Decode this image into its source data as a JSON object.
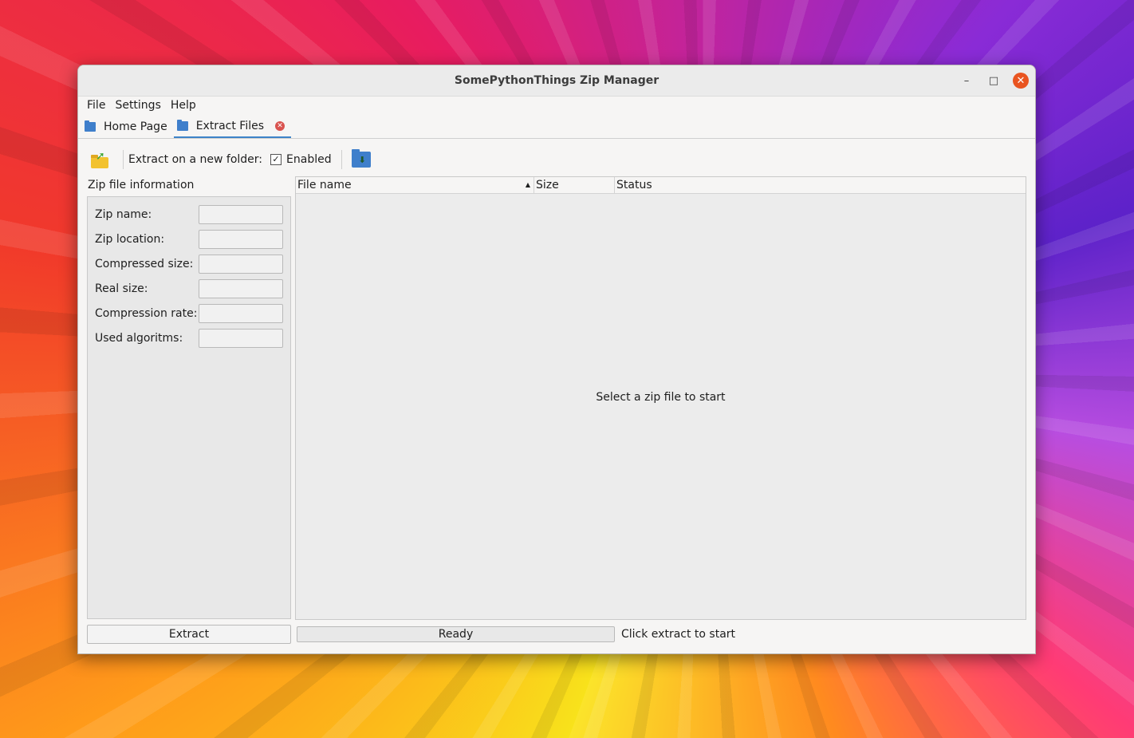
{
  "window": {
    "title": "SomePythonThings Zip Manager"
  },
  "menu": [
    "File",
    "Settings",
    "Help"
  ],
  "tabs": [
    {
      "label": "Home Page",
      "active": false
    },
    {
      "label": "Extract Files",
      "active": true
    }
  ],
  "toolbar": {
    "new_folder_label": "Extract on a new folder:",
    "enabled_label": "Enabled",
    "enabled_checked": true,
    "checkmark": "✓"
  },
  "info": {
    "title": "Zip file information",
    "rows": [
      {
        "label": "Zip name:",
        "value": ""
      },
      {
        "label": "Zip location:",
        "value": ""
      },
      {
        "label": "Compressed size:",
        "value": ""
      },
      {
        "label": "Real size:",
        "value": ""
      },
      {
        "label": "Compression rate:",
        "value": ""
      },
      {
        "label": "Used algoritms:",
        "value": ""
      }
    ]
  },
  "table": {
    "columns": [
      "File name",
      "Size",
      "Status"
    ],
    "sort_indicator": "▲",
    "empty_message": "Select a zip file to start"
  },
  "footer": {
    "extract_button": "Extract",
    "progress_text": "Ready",
    "progress_value": 0,
    "status": "Click extract to start"
  },
  "colors": {
    "accent": "#3d84c8",
    "close": "#e95420",
    "folder": "#3f7fcb"
  }
}
